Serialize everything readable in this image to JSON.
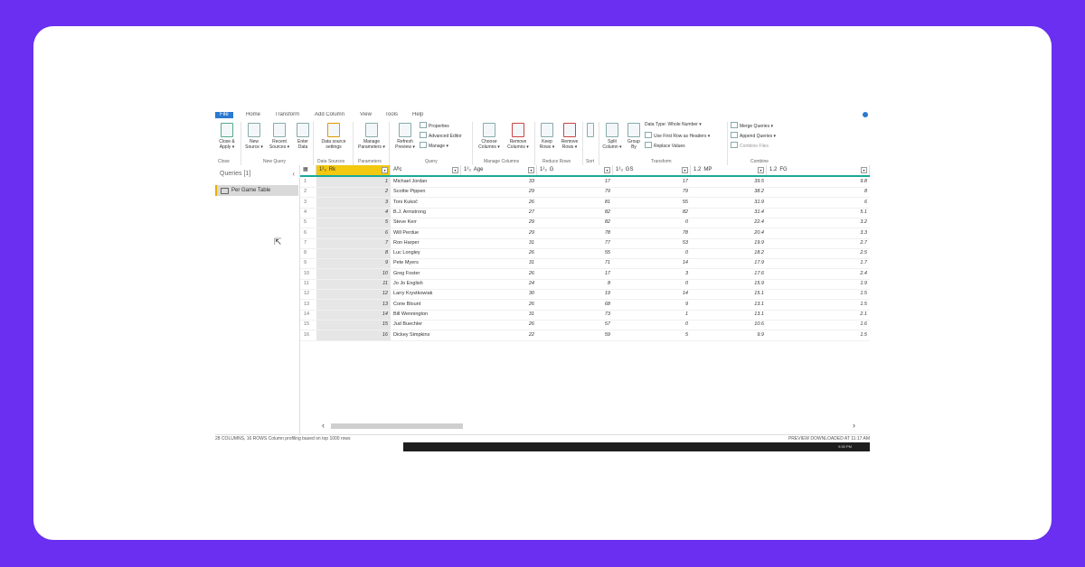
{
  "tabs": [
    "File",
    "Home",
    "Transform",
    "Add Column",
    "View",
    "Tools",
    "Help"
  ],
  "ribbon": {
    "close_apply": "Close & Apply ▾",
    "new_source": "New Source ▾",
    "recent_sources": "Recent Sources ▾",
    "enter_data": "Enter Data",
    "data_source_settings": "Data source settings",
    "manage_parameters": "Manage Parameters ▾",
    "refresh_preview": "Refresh Preview ▾",
    "properties": "Properties",
    "advanced_editor": "Advanced Editor",
    "manage": "Manage ▾",
    "choose_columns": "Choose Columns ▾",
    "remove_columns": "Remove Columns ▾",
    "keep_rows": "Keep Rows ▾",
    "remove_rows": "Remove Rows ▾",
    "split_column": "Split Column ▾",
    "group_by": "Group By",
    "data_type": "Data Type: Whole Number ▾",
    "use_first_row": "Use First Row as Headers ▾",
    "replace_values": "Replace Values",
    "merge_queries": "Merge Queries ▾",
    "append_queries": "Append Queries ▾",
    "combine_files": "Combine Files",
    "groups": [
      "Close",
      "New Query",
      "Data Sources",
      "Parameters",
      "Query",
      "Manage Columns",
      "Reduce Rows",
      "Sort",
      "Transform",
      "Combine"
    ]
  },
  "queries": {
    "header": "Queries [1]",
    "collapse": "‹",
    "items": [
      "Per Game Table"
    ]
  },
  "columns": [
    {
      "type": "1²₃",
      "name": "Rk"
    },
    {
      "type": "Aᴮc",
      "name": ""
    },
    {
      "type": "1²₃",
      "name": "Age"
    },
    {
      "type": "1²₃",
      "name": "G"
    },
    {
      "type": "1²₃",
      "name": "GS"
    },
    {
      "type": "1.2",
      "name": "MP"
    },
    {
      "type": "1.2",
      "name": "FG"
    },
    {
      "type": "1.2",
      "name": ""
    }
  ],
  "rows": [
    [
      "1",
      "1",
      "Michael Jordan",
      "33",
      "17",
      "17",
      "39.5",
      "9.8"
    ],
    [
      "2",
      "2",
      "Scottie Pippen",
      "29",
      "79",
      "79",
      "38.2",
      "8"
    ],
    [
      "3",
      "3",
      "Toni Kukoč",
      "26",
      "81",
      "55",
      "31.9",
      "6"
    ],
    [
      "4",
      "4",
      "B.J. Armstrong",
      "27",
      "82",
      "82",
      "31.4",
      "5.1"
    ],
    [
      "5",
      "5",
      "Steve Kerr",
      "29",
      "82",
      "0",
      "22.4",
      "3.2"
    ],
    [
      "6",
      "6",
      "Will Perdue",
      "29",
      "78",
      "78",
      "20.4",
      "3.3"
    ],
    [
      "7",
      "7",
      "Ron Harper",
      "31",
      "77",
      "53",
      "19.9",
      "2.7"
    ],
    [
      "8",
      "8",
      "Luc Longley",
      "26",
      "55",
      "0",
      "18.2",
      "2.5"
    ],
    [
      "9",
      "9",
      "Pete Myers",
      "31",
      "71",
      "14",
      "17.9",
      "1.7"
    ],
    [
      "10",
      "10",
      "Greg Foster",
      "26",
      "17",
      "3",
      "17.6",
      "2.4"
    ],
    [
      "11",
      "11",
      "Jo Jo English",
      "24",
      "8",
      "0",
      "15.9",
      "1.9"
    ],
    [
      "12",
      "12",
      "Larry Krystkowiak",
      "30",
      "19",
      "14",
      "15.1",
      "1.5"
    ],
    [
      "13",
      "13",
      "Corie Blount",
      "26",
      "68",
      "9",
      "13.1",
      "1.5"
    ],
    [
      "14",
      "14",
      "Bill Wennington",
      "31",
      "73",
      "1",
      "13.1",
      "2.1"
    ],
    [
      "15",
      "15",
      "Jud Buechler",
      "26",
      "57",
      "0",
      "10.6",
      "1.6"
    ],
    [
      "16",
      "16",
      "Dickey Simpkins",
      "22",
      "59",
      "5",
      "9.9",
      "1.5"
    ]
  ],
  "status": {
    "left": "28 COLUMNS, 16 ROWS   Column profiling based on top 1000 rows",
    "right": "PREVIEW DOWNLOADED AT 11:17 AM"
  },
  "taskbar_time": "9:30 PM",
  "colors": {
    "accent": "#1aa89a",
    "selected_header": "#f2c811",
    "frame": "#6a2ff0"
  }
}
